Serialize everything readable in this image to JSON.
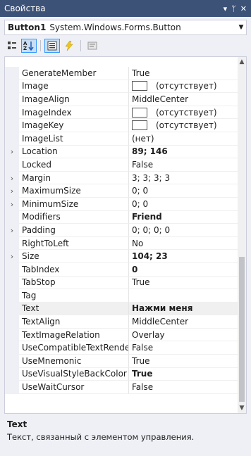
{
  "panel": {
    "title": "Свойства",
    "pin_icon": "pin-icon",
    "close_icon": "close-icon",
    "menu_icon": "dropdown-icon"
  },
  "object_selector": {
    "name": "Button1",
    "type": "System.Windows.Forms.Button"
  },
  "toolbar": {
    "buttons": [
      "categorized-icon",
      "alphabetical-icon",
      "properties-icon",
      "events-icon",
      "property-pages-icon"
    ],
    "active": "alphabetical-icon"
  },
  "properties": [
    {
      "name": "GenerateMember",
      "value": "True",
      "expandable": false,
      "bold": false,
      "swatch": false
    },
    {
      "name": "Image",
      "value": "(отсутствует)",
      "expandable": false,
      "bold": false,
      "swatch": true
    },
    {
      "name": "ImageAlign",
      "value": "MiddleCenter",
      "expandable": false,
      "bold": false,
      "swatch": false
    },
    {
      "name": "ImageIndex",
      "value": "(отсутствует)",
      "expandable": false,
      "bold": false,
      "swatch": true
    },
    {
      "name": "ImageKey",
      "value": "(отсутствует)",
      "expandable": false,
      "bold": false,
      "swatch": true
    },
    {
      "name": "ImageList",
      "value": "(нет)",
      "expandable": false,
      "bold": false,
      "swatch": false
    },
    {
      "name": "Location",
      "value": "89; 146",
      "expandable": true,
      "bold": true,
      "swatch": false
    },
    {
      "name": "Locked",
      "value": "False",
      "expandable": false,
      "bold": false,
      "swatch": false
    },
    {
      "name": "Margin",
      "value": "3; 3; 3; 3",
      "expandable": true,
      "bold": false,
      "swatch": false
    },
    {
      "name": "MaximumSize",
      "value": "0; 0",
      "expandable": true,
      "bold": false,
      "swatch": false
    },
    {
      "name": "MinimumSize",
      "value": "0; 0",
      "expandable": true,
      "bold": false,
      "swatch": false
    },
    {
      "name": "Modifiers",
      "value": "Friend",
      "expandable": false,
      "bold": true,
      "swatch": false
    },
    {
      "name": "Padding",
      "value": "0; 0; 0; 0",
      "expandable": true,
      "bold": false,
      "swatch": false
    },
    {
      "name": "RightToLeft",
      "value": "No",
      "expandable": false,
      "bold": false,
      "swatch": false
    },
    {
      "name": "Size",
      "value": "104; 23",
      "expandable": true,
      "bold": true,
      "swatch": false
    },
    {
      "name": "TabIndex",
      "value": "0",
      "expandable": false,
      "bold": true,
      "swatch": false
    },
    {
      "name": "TabStop",
      "value": "True",
      "expandable": false,
      "bold": false,
      "swatch": false
    },
    {
      "name": "Tag",
      "value": "",
      "expandable": false,
      "bold": false,
      "swatch": false
    },
    {
      "name": "Text",
      "value": "Нажми меня",
      "expandable": false,
      "bold": true,
      "swatch": false,
      "selected": true
    },
    {
      "name": "TextAlign",
      "value": "MiddleCenter",
      "expandable": false,
      "bold": false,
      "swatch": false
    },
    {
      "name": "TextImageRelation",
      "value": "Overlay",
      "expandable": false,
      "bold": false,
      "swatch": false
    },
    {
      "name": "UseCompatibleTextRende",
      "value": "False",
      "expandable": false,
      "bold": false,
      "swatch": false
    },
    {
      "name": "UseMnemonic",
      "value": "True",
      "expandable": false,
      "bold": false,
      "swatch": false
    },
    {
      "name": "UseVisualStyleBackColor",
      "value": "True",
      "expandable": false,
      "bold": true,
      "swatch": false
    },
    {
      "name": "UseWaitCursor",
      "value": "False",
      "expandable": false,
      "bold": false,
      "swatch": false
    }
  ],
  "description": {
    "title": "Text",
    "text": "Текст, связанный с элементом управления."
  }
}
